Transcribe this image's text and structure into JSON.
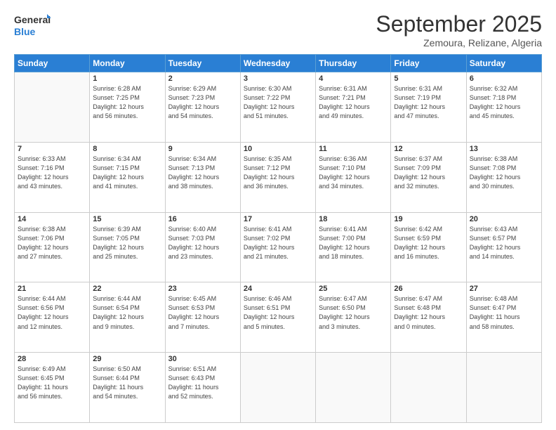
{
  "logo": {
    "line1": "General",
    "line2": "Blue"
  },
  "title": "September 2025",
  "subtitle": "Zemoura, Relizane, Algeria",
  "weekdays": [
    "Sunday",
    "Monday",
    "Tuesday",
    "Wednesday",
    "Thursday",
    "Friday",
    "Saturday"
  ],
  "weeks": [
    [
      {
        "day": "",
        "info": ""
      },
      {
        "day": "1",
        "info": "Sunrise: 6:28 AM\nSunset: 7:25 PM\nDaylight: 12 hours\nand 56 minutes."
      },
      {
        "day": "2",
        "info": "Sunrise: 6:29 AM\nSunset: 7:23 PM\nDaylight: 12 hours\nand 54 minutes."
      },
      {
        "day": "3",
        "info": "Sunrise: 6:30 AM\nSunset: 7:22 PM\nDaylight: 12 hours\nand 51 minutes."
      },
      {
        "day": "4",
        "info": "Sunrise: 6:31 AM\nSunset: 7:21 PM\nDaylight: 12 hours\nand 49 minutes."
      },
      {
        "day": "5",
        "info": "Sunrise: 6:31 AM\nSunset: 7:19 PM\nDaylight: 12 hours\nand 47 minutes."
      },
      {
        "day": "6",
        "info": "Sunrise: 6:32 AM\nSunset: 7:18 PM\nDaylight: 12 hours\nand 45 minutes."
      }
    ],
    [
      {
        "day": "7",
        "info": "Sunrise: 6:33 AM\nSunset: 7:16 PM\nDaylight: 12 hours\nand 43 minutes."
      },
      {
        "day": "8",
        "info": "Sunrise: 6:34 AM\nSunset: 7:15 PM\nDaylight: 12 hours\nand 41 minutes."
      },
      {
        "day": "9",
        "info": "Sunrise: 6:34 AM\nSunset: 7:13 PM\nDaylight: 12 hours\nand 38 minutes."
      },
      {
        "day": "10",
        "info": "Sunrise: 6:35 AM\nSunset: 7:12 PM\nDaylight: 12 hours\nand 36 minutes."
      },
      {
        "day": "11",
        "info": "Sunrise: 6:36 AM\nSunset: 7:10 PM\nDaylight: 12 hours\nand 34 minutes."
      },
      {
        "day": "12",
        "info": "Sunrise: 6:37 AM\nSunset: 7:09 PM\nDaylight: 12 hours\nand 32 minutes."
      },
      {
        "day": "13",
        "info": "Sunrise: 6:38 AM\nSunset: 7:08 PM\nDaylight: 12 hours\nand 30 minutes."
      }
    ],
    [
      {
        "day": "14",
        "info": "Sunrise: 6:38 AM\nSunset: 7:06 PM\nDaylight: 12 hours\nand 27 minutes."
      },
      {
        "day": "15",
        "info": "Sunrise: 6:39 AM\nSunset: 7:05 PM\nDaylight: 12 hours\nand 25 minutes."
      },
      {
        "day": "16",
        "info": "Sunrise: 6:40 AM\nSunset: 7:03 PM\nDaylight: 12 hours\nand 23 minutes."
      },
      {
        "day": "17",
        "info": "Sunrise: 6:41 AM\nSunset: 7:02 PM\nDaylight: 12 hours\nand 21 minutes."
      },
      {
        "day": "18",
        "info": "Sunrise: 6:41 AM\nSunset: 7:00 PM\nDaylight: 12 hours\nand 18 minutes."
      },
      {
        "day": "19",
        "info": "Sunrise: 6:42 AM\nSunset: 6:59 PM\nDaylight: 12 hours\nand 16 minutes."
      },
      {
        "day": "20",
        "info": "Sunrise: 6:43 AM\nSunset: 6:57 PM\nDaylight: 12 hours\nand 14 minutes."
      }
    ],
    [
      {
        "day": "21",
        "info": "Sunrise: 6:44 AM\nSunset: 6:56 PM\nDaylight: 12 hours\nand 12 minutes."
      },
      {
        "day": "22",
        "info": "Sunrise: 6:44 AM\nSunset: 6:54 PM\nDaylight: 12 hours\nand 9 minutes."
      },
      {
        "day": "23",
        "info": "Sunrise: 6:45 AM\nSunset: 6:53 PM\nDaylight: 12 hours\nand 7 minutes."
      },
      {
        "day": "24",
        "info": "Sunrise: 6:46 AM\nSunset: 6:51 PM\nDaylight: 12 hours\nand 5 minutes."
      },
      {
        "day": "25",
        "info": "Sunrise: 6:47 AM\nSunset: 6:50 PM\nDaylight: 12 hours\nand 3 minutes."
      },
      {
        "day": "26",
        "info": "Sunrise: 6:47 AM\nSunset: 6:48 PM\nDaylight: 12 hours\nand 0 minutes."
      },
      {
        "day": "27",
        "info": "Sunrise: 6:48 AM\nSunset: 6:47 PM\nDaylight: 11 hours\nand 58 minutes."
      }
    ],
    [
      {
        "day": "28",
        "info": "Sunrise: 6:49 AM\nSunset: 6:45 PM\nDaylight: 11 hours\nand 56 minutes."
      },
      {
        "day": "29",
        "info": "Sunrise: 6:50 AM\nSunset: 6:44 PM\nDaylight: 11 hours\nand 54 minutes."
      },
      {
        "day": "30",
        "info": "Sunrise: 6:51 AM\nSunset: 6:43 PM\nDaylight: 11 hours\nand 52 minutes."
      },
      {
        "day": "",
        "info": ""
      },
      {
        "day": "",
        "info": ""
      },
      {
        "day": "",
        "info": ""
      },
      {
        "day": "",
        "info": ""
      }
    ]
  ]
}
